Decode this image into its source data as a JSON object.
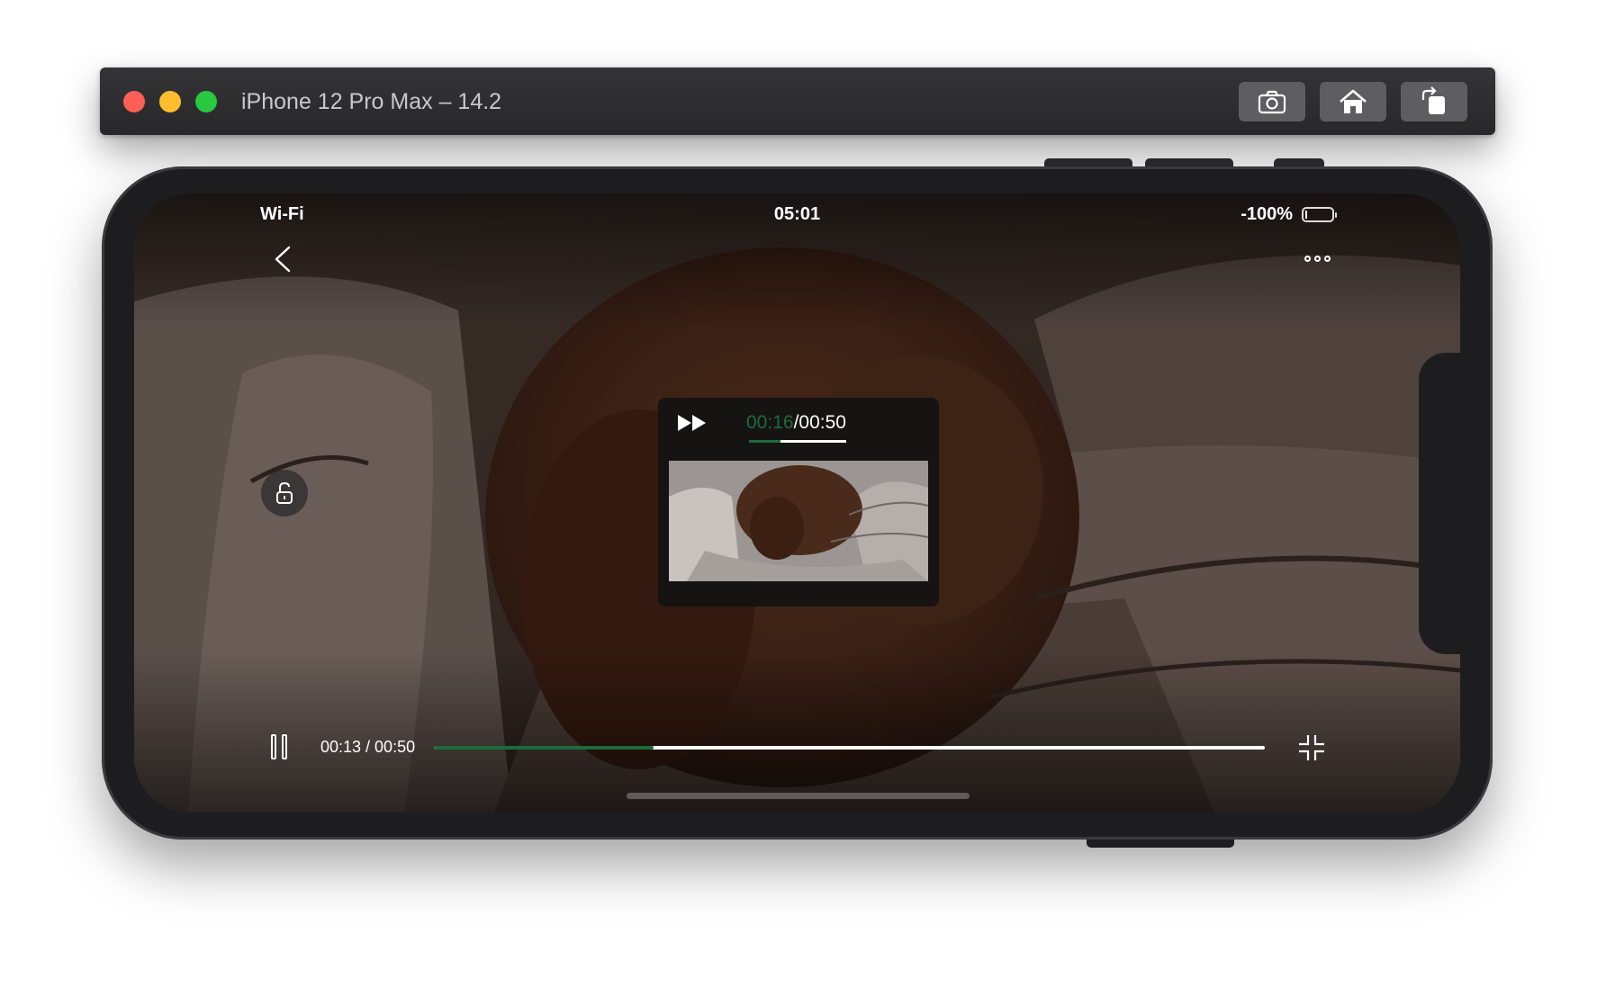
{
  "window": {
    "title": "iPhone 12 Pro Max – 14.2",
    "toolbar_icons": [
      "screenshot-icon",
      "home-icon",
      "rotate-icon"
    ]
  },
  "status_bar": {
    "network": "Wi-Fi",
    "time": "05:01",
    "battery": "-100%"
  },
  "player": {
    "top_icons": [
      "back-chevron-icon",
      "more-icon"
    ],
    "lock_icon": "unlock-icon",
    "preview": {
      "current": "00:16",
      "separator_total": "/00:50",
      "progress_fraction": 0.32
    },
    "controls": {
      "time_label": "00:13 / 00:50",
      "progress_fraction": 0.264
    },
    "icons": [
      "pause-icon",
      "exit-fullscreen-icon",
      "fast-forward-icon"
    ]
  },
  "colors": {
    "accent": "#1c6b3a",
    "close": "#fe5f57",
    "minimize": "#febc2e",
    "maximize": "#28c840"
  }
}
